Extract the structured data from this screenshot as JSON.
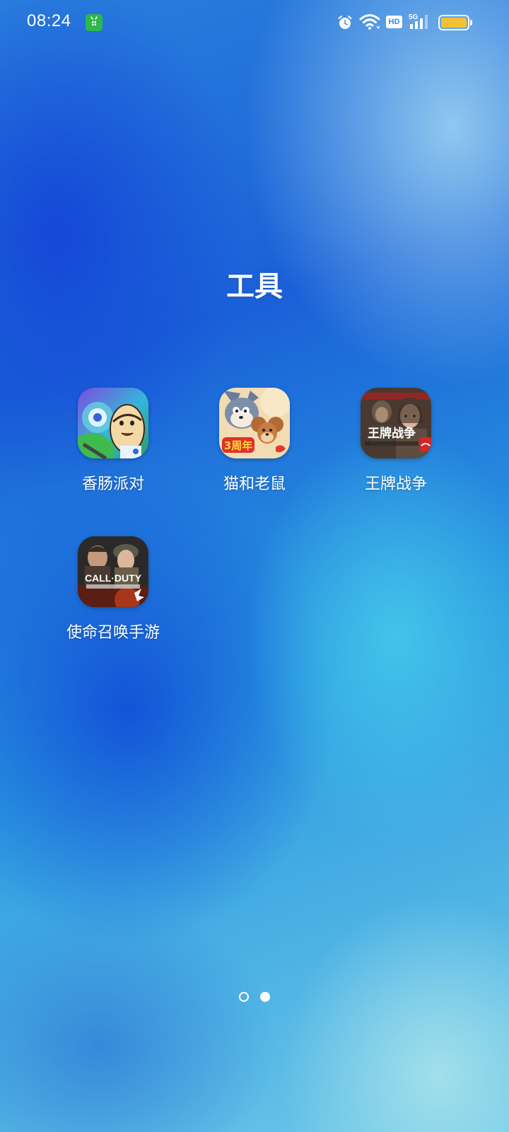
{
  "status_bar": {
    "time": "08:24",
    "icons": [
      "notification-app-icon",
      "alarm-icon",
      "wifi-icon",
      "hd-icon",
      "signal-5g-icon",
      "battery-icon"
    ],
    "hd_label": "HD",
    "network_label": "5G",
    "battery_color": "#f2c233"
  },
  "folder": {
    "title": "工具",
    "apps": [
      {
        "label": "香肠派对",
        "icon": "sausage-party-app-icon"
      },
      {
        "label": "猫和老鼠",
        "icon": "tom-and-jerry-app-icon",
        "icon_text": "3周年"
      },
      {
        "label": "王牌战争",
        "icon": "ace-war-app-icon",
        "icon_text": "王牌战争"
      },
      {
        "label": "使命召唤手游",
        "icon": "call-of-duty-mobile-app-icon",
        "icon_text": "CALL·DUTY"
      }
    ]
  },
  "page_indicator": {
    "total": 2,
    "active_index": 1
  }
}
